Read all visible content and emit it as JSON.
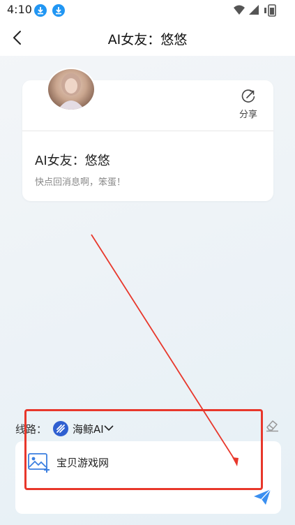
{
  "status": {
    "time": "4:10"
  },
  "header": {
    "title": "AI女友：悠悠"
  },
  "card": {
    "share_label": "分享",
    "name": "AI女友：悠悠",
    "description": "快点回消息啊，笨蛋！"
  },
  "route": {
    "label": "线路：",
    "name": "海鲸AI"
  },
  "input": {
    "value": "宝贝游戏网"
  },
  "colors": {
    "accent": "#2196f3",
    "annotation": "#e8372b",
    "send": "#3b8ff0"
  }
}
